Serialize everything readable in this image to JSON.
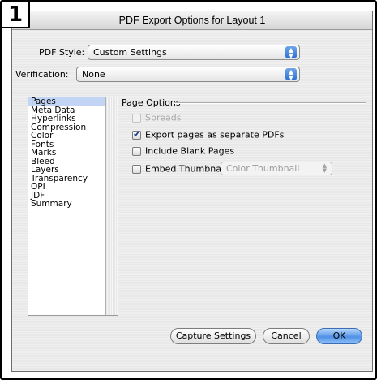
{
  "step_badge": "1",
  "dialog": {
    "title": "PDF Export Options for Layout 1",
    "pdf_style": {
      "label": "PDF Style:",
      "value": "Custom Settings"
    },
    "verification": {
      "label": "Verification:",
      "value": "None"
    },
    "categories": [
      "Pages",
      "Meta Data",
      "Hyperlinks",
      "Compression",
      "Color",
      "Fonts",
      "Marks",
      "Bleed",
      "Layers",
      "Transparency",
      "OPI",
      "JDF",
      "Summary"
    ],
    "selected_category": "Pages",
    "page_options": {
      "title": "Page Options",
      "spreads": "Spreads",
      "export_separate": "Export pages as separate PDFs",
      "include_blank": "Include Blank Pages",
      "embed_thumbnail": "Embed Thumbnail",
      "thumbnail_type": "Color Thumbnail"
    },
    "buttons": {
      "capture": "Capture Settings",
      "cancel": "Cancel",
      "ok": "OK"
    }
  },
  "colors": {
    "selection": "#c3d5f5",
    "accent": "#2c6fd3"
  }
}
